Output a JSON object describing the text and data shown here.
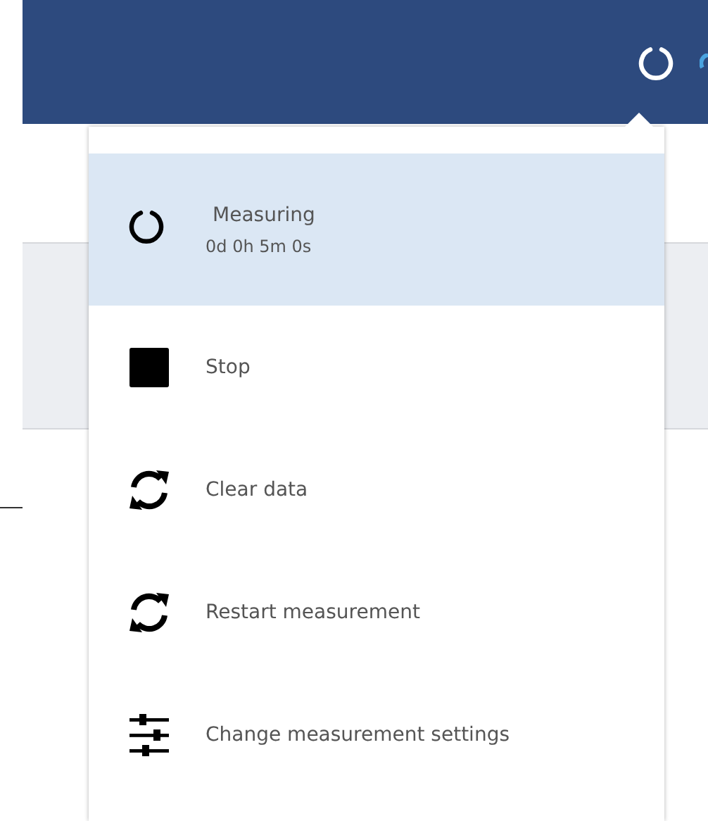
{
  "menu": {
    "items": [
      {
        "kind": "spinner",
        "label": "Measuring",
        "subtitle": "0d 0h 5m 0s",
        "selected": true
      },
      {
        "kind": "stop",
        "label": "Stop",
        "selected": false
      },
      {
        "kind": "refresh",
        "label": "Clear data",
        "selected": false
      },
      {
        "kind": "refresh",
        "label": "Restart measurement",
        "selected": false
      },
      {
        "kind": "sliders",
        "label": "Change measurement settings",
        "selected": false
      }
    ]
  }
}
